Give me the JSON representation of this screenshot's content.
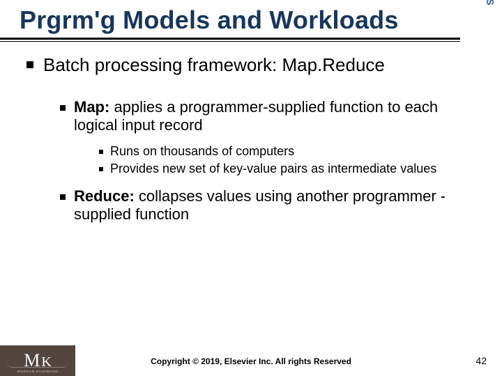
{
  "title": "Prgrm'g Models and Workloads",
  "sidebar_label": "Programming Models and Workloads for WSCs",
  "body": {
    "lvl1_text": "Batch processing framework:  Map.Reduce",
    "map_label": "Map:",
    "map_text": " applies a programmer-supplied function to each logical input record",
    "map_sub1": "Runs on thousands of computers",
    "map_sub2": "Provides new set of key-value pairs as intermediate values",
    "reduce_label": "Reduce:",
    "reduce_text": "  collapses values using another programmer -supplied function"
  },
  "footer": {
    "logo_letters_m": "M",
    "logo_letters_k": "K",
    "logo_sub": "MORGAN KAUFMANN",
    "copyright": "Copyright © 2019, Elsevier Inc. All rights Reserved",
    "page": "42"
  }
}
